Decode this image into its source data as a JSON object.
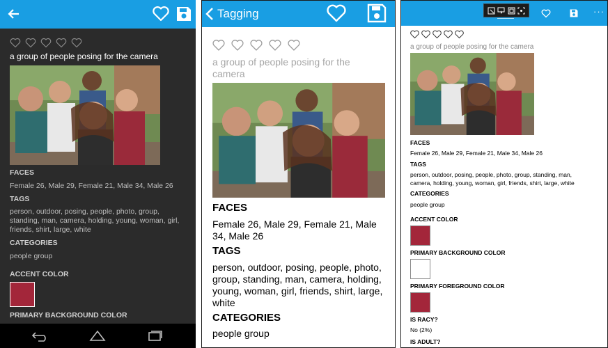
{
  "content": {
    "caption": "a group of people posing for the camera",
    "faces_heading": "FACES",
    "faces": "Female 26, Male 29, Female 21, Male 34, Male 26",
    "tags_heading": "TAGS",
    "tags": "person, outdoor, posing, people, photo, group, standing, man, camera, holding, young, woman, girl, friends, shirt, large, white",
    "categories_heading": "CATEGORIES",
    "categories": "people group",
    "accent_color_heading": "ACCENT COLOR",
    "primary_background_heading": "PRIMARY BACKGROUND COLOR",
    "primary_foreground_heading": "PRIMARY FOREGROUND COLOR",
    "is_racy_heading": "IS RACY?",
    "is_racy": "No  (2%)",
    "is_adult_heading": "IS ADULT?",
    "rating": 0,
    "rating_max": 5
  },
  "android": {
    "back_icon": "arrow-left-icon",
    "favorite_icon": "heart-outline-icon",
    "save_icon": "save-icon",
    "nav_icons": [
      "back-nav-icon",
      "home-nav-icon",
      "recent-apps-icon"
    ]
  },
  "ios": {
    "back_label": "Tagging",
    "back_icon": "chevron-left-icon",
    "favorite_icon": "heart-outline-icon",
    "save_icon": "save-icon"
  },
  "windows": {
    "toolbar_icons": [
      "select-icon",
      "cursor-icon",
      "window-icon",
      "scan-icon"
    ],
    "favorite_icon": "heart-outline-icon",
    "save_icon": "save-icon",
    "more_label": "···"
  },
  "colors": {
    "app_bar": "#199ee3",
    "accent": "#a3263a",
    "primary_background": "#ffffff",
    "primary_foreground": "#a3263a",
    "android_background": "#2b2b2b"
  }
}
